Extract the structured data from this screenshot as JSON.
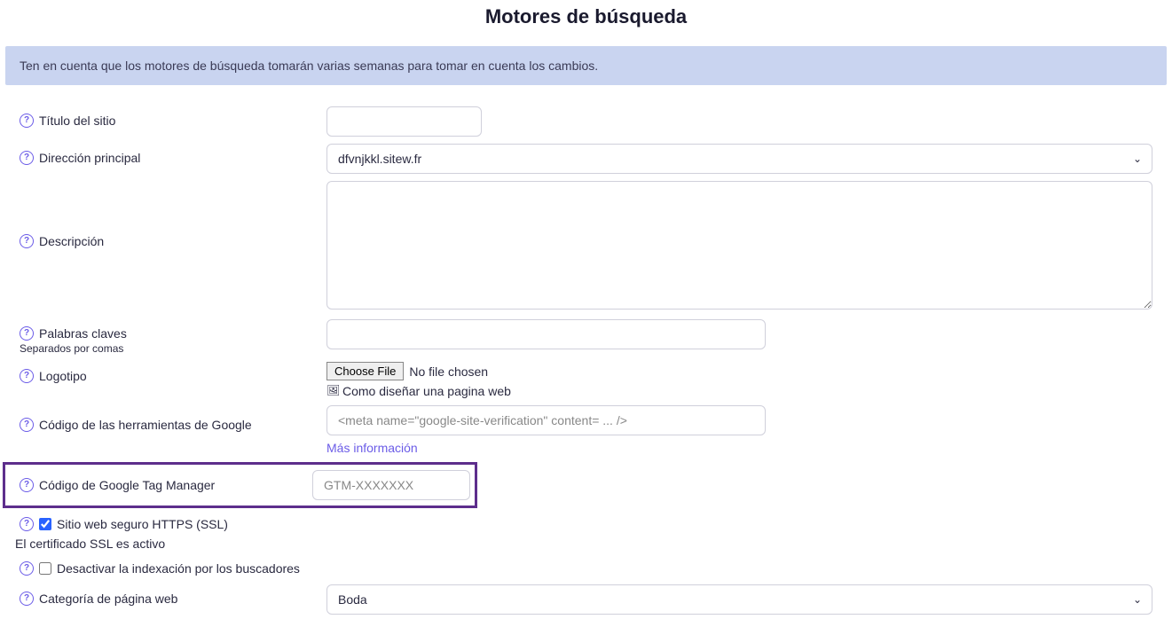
{
  "title": "Motores de búsqueda",
  "banner": "Ten en cuenta que los motores de búsqueda tomarán varias semanas para tomar en cuenta los cambios.",
  "labels": {
    "site_title": "Título del sitio",
    "main_address": "Dirección principal",
    "description": "Descripción",
    "keywords": "Palabras claves",
    "keywords_hint": "Separados por comas",
    "logo": "Logotipo",
    "google_tools": "Código de las herramientas de Google",
    "gtm": "Código de Google Tag Manager",
    "https": "Sitio web seguro HTTPS (SSL)",
    "no_index": "Desactivar la indexación por los buscadores",
    "category": "Categoría de página web"
  },
  "values": {
    "main_address": "dfvnjkkl.sitew.fr",
    "site_title": "",
    "description": "",
    "keywords": "",
    "google_tools": "",
    "gtm": "",
    "https_checked": true,
    "no_index_checked": false,
    "category": "Boda"
  },
  "placeholders": {
    "google_tools": "<meta name=\"google-site-verification\" content= ... />",
    "gtm": "GTM-XXXXXXX"
  },
  "file": {
    "button": "Choose File",
    "status": "No file chosen",
    "alt": "Como diseñar una pagina web"
  },
  "more_info": "Más información",
  "ssl_status": "El certificado SSL es activo"
}
